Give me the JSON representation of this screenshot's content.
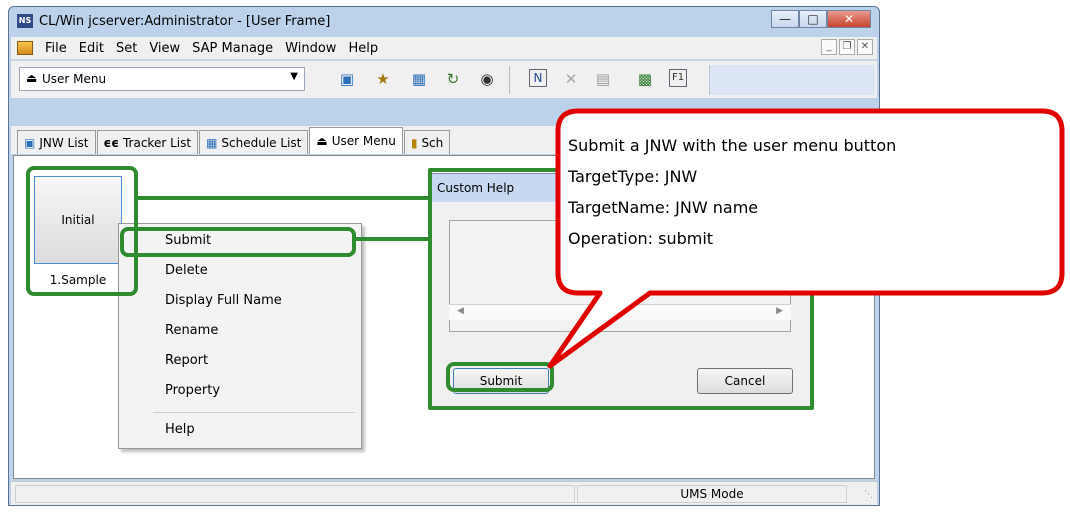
{
  "window": {
    "app_icon": "NS",
    "title": "CL/Win jcserver:Administrator - [User Frame]",
    "caption_buttons": [
      "minimize-icon",
      "maximize-icon",
      "close-icon"
    ]
  },
  "menubar": {
    "items": [
      "File",
      "Edit",
      "Set",
      "View",
      "SAP Manage",
      "Window",
      "Help"
    ]
  },
  "toolbar": {
    "combo_value": "User Menu"
  },
  "tabs": [
    {
      "label": "JNW List",
      "icon": "jnw-list-icon"
    },
    {
      "label": "Tracker List",
      "icon": "tracker-icon"
    },
    {
      "label": "Schedule List",
      "icon": "schedule-icon"
    },
    {
      "label": "User Menu",
      "icon": "user-menu-icon",
      "active": true
    },
    {
      "label": "Sch",
      "icon": "schedule-chart-icon"
    }
  ],
  "user_menu_button": {
    "label": "Initial",
    "caption": "1.Sample"
  },
  "context_menu": {
    "items": [
      "Submit",
      "Delete",
      "Display Full Name",
      "Rename",
      "Report",
      "Property",
      "Help"
    ]
  },
  "dialog": {
    "title": "Custom Help",
    "submit_label": "Submit",
    "cancel_label": "Cancel"
  },
  "status": {
    "mode": "UMS Mode"
  },
  "callout": {
    "lines": [
      "Submit a JNW with the user menu button",
      "TargetType: JNW",
      "TargetName: JNW name",
      "Operation: submit"
    ]
  },
  "colors": {
    "highlight_green": "#2e8b2e",
    "callout_red": "#e00000"
  }
}
